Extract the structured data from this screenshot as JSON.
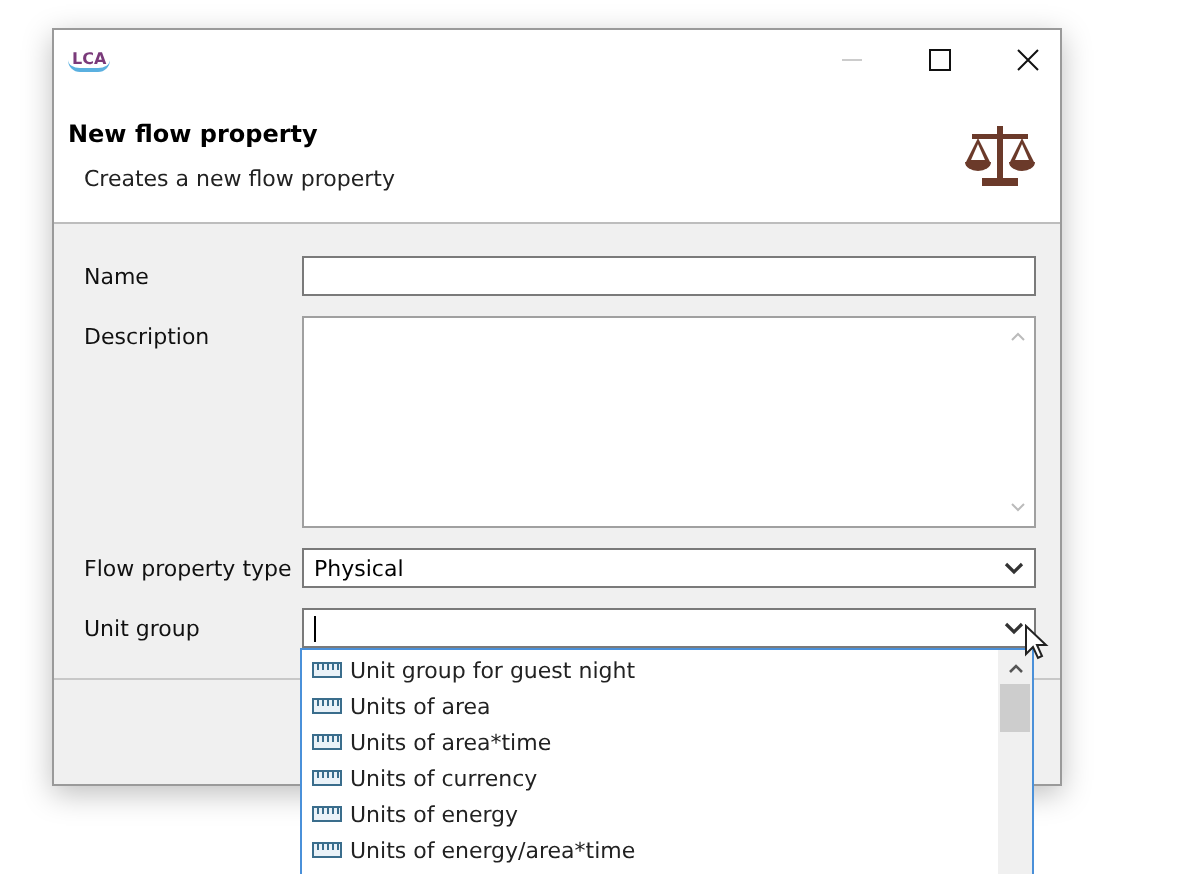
{
  "window": {
    "logo": "LCA"
  },
  "header": {
    "title": "New flow property",
    "subtitle": "Creates a new flow property"
  },
  "form": {
    "name": {
      "label": "Name"
    },
    "description": {
      "label": "Description"
    },
    "flow_property_type": {
      "label": "Flow property type",
      "value": "Physical"
    },
    "unit_group": {
      "label": "Unit group"
    }
  },
  "dropdown": {
    "expanded": true,
    "items": [
      {
        "label": "Unit group for guest night"
      },
      {
        "label": "Units of area"
      },
      {
        "label": "Units of area*time"
      },
      {
        "label": "Units of currency"
      },
      {
        "label": "Units of energy"
      },
      {
        "label": "Units of energy/area*time"
      }
    ]
  }
}
